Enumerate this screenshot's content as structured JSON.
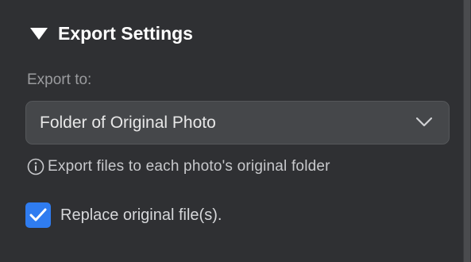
{
  "section": {
    "title": "Export Settings",
    "expanded": true,
    "toggle_icon": "disclosure-triangle-down"
  },
  "export_to": {
    "label": "Export to:",
    "selected": "Folder of Original Photo",
    "dropdown_icon": "chevron-down"
  },
  "info": {
    "icon": "info-circle",
    "text": "Export files to each photo's original folder"
  },
  "replace_original": {
    "label": "Replace original file(s).",
    "checked": true
  },
  "colors": {
    "background": "#2f3033",
    "accent": "#2f7cf0"
  }
}
